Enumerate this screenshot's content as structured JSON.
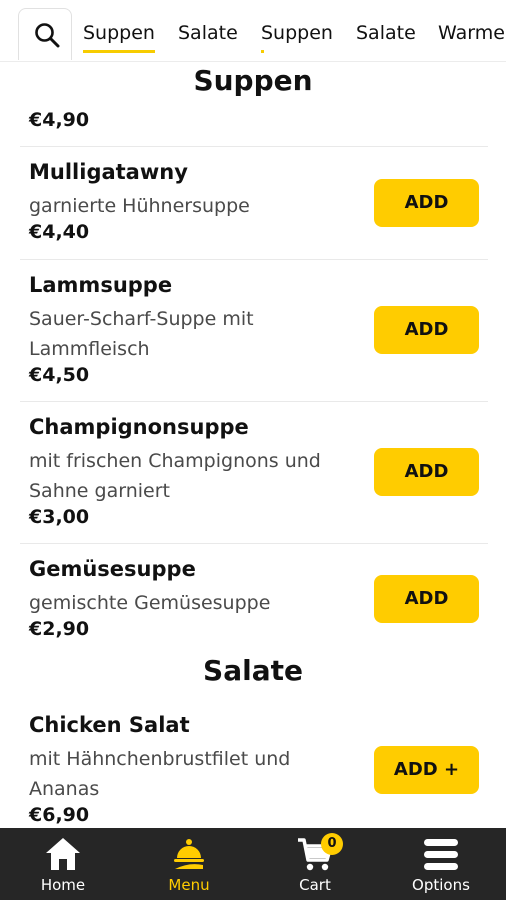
{
  "tabs": [
    {
      "label": "Suppen",
      "active": true
    },
    {
      "label": "Salate",
      "active": false
    },
    {
      "label": "Suppen",
      "active": false
    },
    {
      "label": "Salate",
      "active": false
    },
    {
      "label": "Warme",
      "active": false
    }
  ],
  "sections": [
    {
      "title": "Suppen",
      "lead_price": "€4,90",
      "items": [
        {
          "name": "Mulligatawny",
          "desc": "garnierte Hühnersuppe",
          "price": "€4,40",
          "button": "ADD"
        },
        {
          "name": "Lammsuppe",
          "desc": "Sauer-Scharf-Suppe mit Lammfleisch",
          "price": "€4,50",
          "button": "ADD"
        },
        {
          "name": "Champignonsuppe",
          "desc": "mit frischen Champignons und Sahne garniert",
          "price": "€3,00",
          "button": "ADD"
        },
        {
          "name": "Gemüsesuppe",
          "desc": "gemischte Gemüsesuppe",
          "price": "€2,90",
          "button": "ADD"
        }
      ]
    },
    {
      "title": "Salate",
      "items": [
        {
          "name": "Chicken Salat",
          "desc": "mit Hähnchenbrustfilet und Ananas",
          "price": "€6,90",
          "button": "ADD +"
        }
      ]
    }
  ],
  "nav": {
    "home": "Home",
    "menu": "Menu",
    "cart": "Cart",
    "cart_count": "0",
    "options": "Options"
  },
  "colors": {
    "accent": "#ffcc00",
    "nav_bg": "#262626"
  },
  "icons": {
    "search": "search-icon",
    "home": "home-icon",
    "menu": "food-cloche-icon",
    "cart": "cart-icon",
    "options": "menu-lines-icon"
  }
}
